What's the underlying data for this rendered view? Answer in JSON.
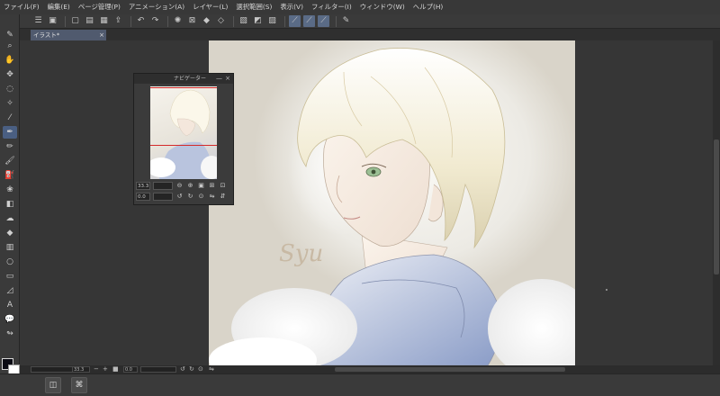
{
  "menubar": {
    "items": [
      "ファイル(F)",
      "編集(E)",
      "ページ管理(P)",
      "アニメーション(A)",
      "レイヤー(L)",
      "選択範囲(S)",
      "表示(V)",
      "フィルター(I)",
      "ウィンドウ(W)",
      "ヘルプ(H)"
    ]
  },
  "canvas": {
    "tab_label": "イラスト*",
    "tab_close": "×"
  },
  "artwork": {
    "signature": "Syu"
  },
  "navigator": {
    "title": "ナビゲーター",
    "minimize": "—",
    "close": "×",
    "zoom_value": "33.3",
    "angle_value": "0.0"
  },
  "statusbar": {
    "zoom_value": "33.3",
    "angle_value": "0.0"
  },
  "colors": {
    "main_color": "#0b0b14",
    "sub_color": "#ffffff",
    "accent": "#4a5f82",
    "nav_frame": "#d42a2a"
  },
  "icons": {
    "tools": [
      "zoom-icon",
      "hand-icon",
      "move-icon",
      "lasso-select-icon",
      "magic-wand-icon",
      "eyedropper-icon",
      "pen-icon",
      "pencil-icon",
      "brush-icon",
      "airbrush-icon",
      "decoration-icon",
      "eraser-icon",
      "blend-icon",
      "fill-icon",
      "gradient-icon",
      "figure-icon",
      "frame-border-icon",
      "ruler-icon",
      "text-icon",
      "balloon-icon",
      "correct-line-icon"
    ]
  }
}
